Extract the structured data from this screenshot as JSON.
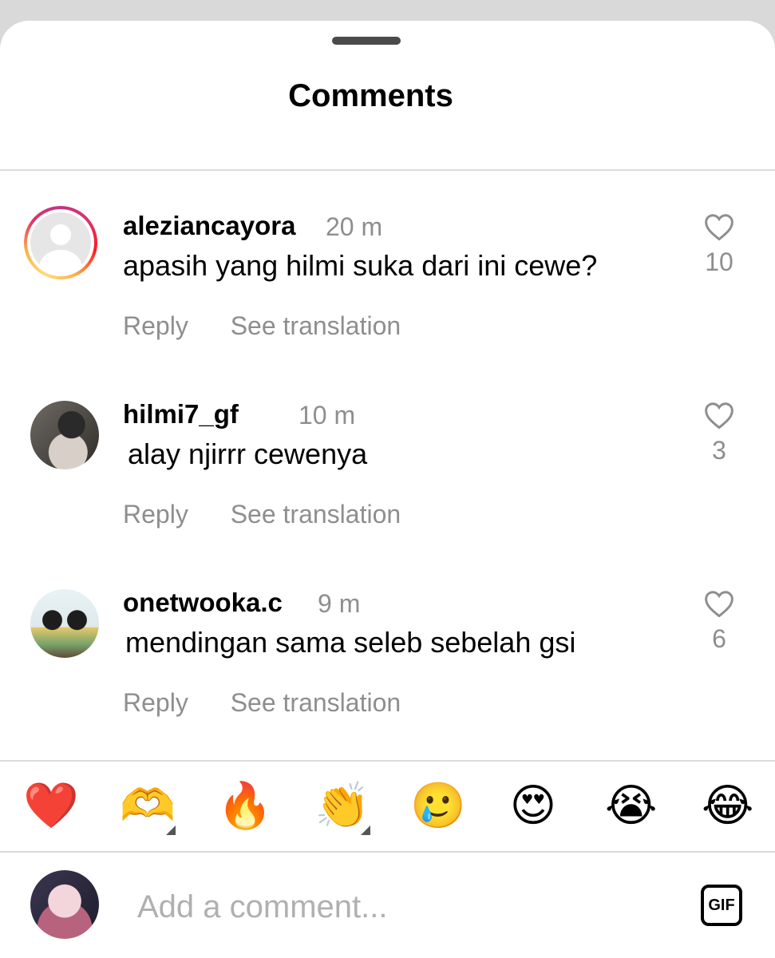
{
  "sheet": {
    "title": "Comments"
  },
  "comments": [
    {
      "username": "aleziancayora",
      "time": "20 m",
      "text": "apasih yang hilmi suka dari ini cewe?",
      "likes": "10",
      "reply_label": "Reply",
      "translate_label": "See translation",
      "avatar_icon": "default-avatar-icon",
      "has_story_ring": true
    },
    {
      "username": "hilmi7_gf",
      "time": "10 m",
      "text": "alay njirrr cewenya",
      "likes": "3",
      "reply_label": "Reply",
      "translate_label": "See translation",
      "has_story_ring": false
    },
    {
      "username": "onetwooka.c",
      "time": "9 m",
      "text": "mendingan sama seleb sebelah gsi",
      "likes": "6",
      "reply_label": "Reply",
      "translate_label": "See translation",
      "has_story_ring": false
    }
  ],
  "reactions": [
    {
      "name": "red-heart",
      "glyph": "❤️"
    },
    {
      "name": "heart-hands",
      "glyph": "🫶",
      "has_variants": true
    },
    {
      "name": "fire",
      "glyph": "🔥"
    },
    {
      "name": "clapping-hands",
      "glyph": "👏",
      "has_variants": true
    },
    {
      "name": "face-holding-back-tears",
      "glyph": "🥲"
    },
    {
      "name": "heart-eyes",
      "glyph": "😍"
    },
    {
      "name": "loudly-crying-face",
      "glyph": "😭"
    },
    {
      "name": "tears-of-joy",
      "glyph": "😂"
    }
  ],
  "composer": {
    "placeholder": "Add a comment...",
    "gif_label": "GIF"
  },
  "colors": {
    "text": "#000000",
    "muted": "#8e8e8e",
    "divider": "#dbdbdb",
    "backdrop": "#d9d9d9",
    "story_ring": [
      "#c13584",
      "#fd1d1d",
      "#fcaf45"
    ]
  }
}
